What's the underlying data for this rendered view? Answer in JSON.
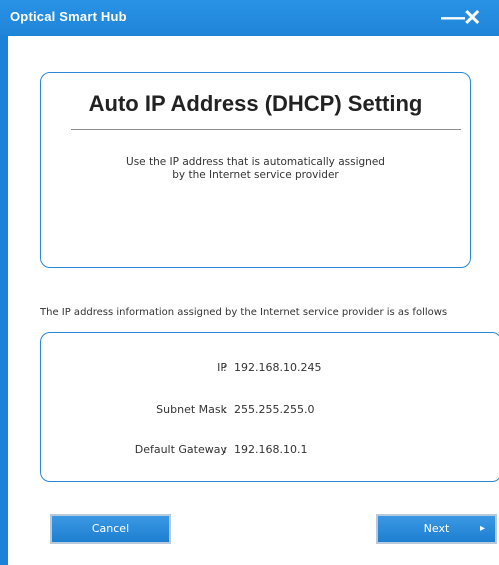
{
  "window": {
    "title": "Optical Smart Hub",
    "minimize_glyph": "—",
    "close_glyph": "✕"
  },
  "header_panel": {
    "title": "Auto IP Address (DHCP) Setting",
    "description_line1": "Use the IP address that is automatically assigned",
    "description_line2": "by the Internet service provider"
  },
  "info": {
    "caption": "The IP address information assigned by the Internet service provider is as follows",
    "rows": [
      {
        "label": "IP",
        "value": "192.168.10.245"
      },
      {
        "label": "Subnet Mask",
        "value": "255.255.255.0"
      },
      {
        "label": "Default Gateway",
        "value": "192.168.10.1"
      }
    ]
  },
  "buttons": {
    "cancel_label": "Cancel",
    "next_label": "Next",
    "next_arrow": "▸"
  },
  "colors": {
    "accent": "#1e84d8",
    "panel_border": "#2a88d6"
  }
}
